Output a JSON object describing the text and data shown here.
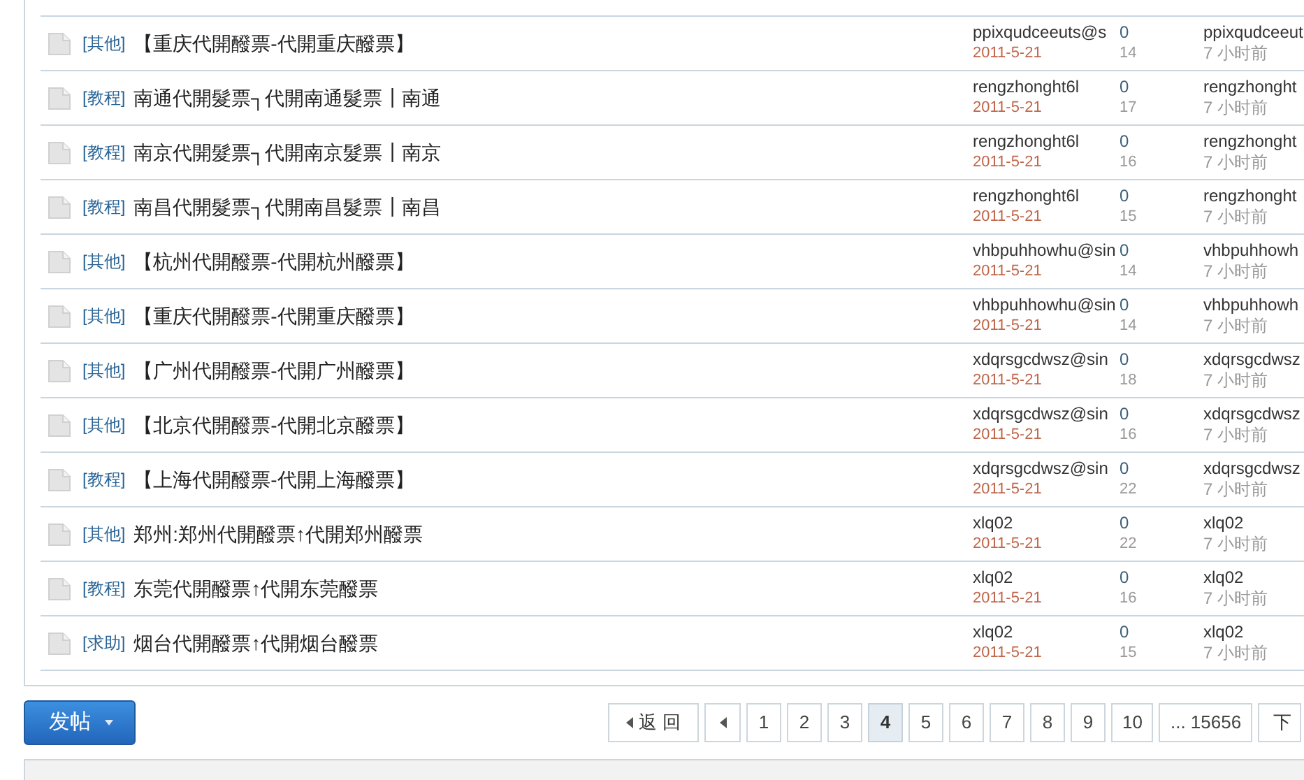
{
  "threads": [
    {
      "category": "[其他]",
      "title": "【重庆代開醱票-代開重庆醱票】",
      "author": "ppixqudceeuts@s",
      "date": "2011-5-21",
      "replies": "0",
      "views": "14",
      "last_poster": "ppixqudceeut",
      "last_time": "7 小时前"
    },
    {
      "category": "[教程]",
      "title": "南通代開髮票┐代開南通髮票┃南通",
      "author": "rengzhonght6l",
      "date": "2011-5-21",
      "replies": "0",
      "views": "17",
      "last_poster": "rengzhonght",
      "last_time": "7 小时前"
    },
    {
      "category": "[教程]",
      "title": "南京代開髮票┐代開南京髮票┃南京",
      "author": "rengzhonght6l",
      "date": "2011-5-21",
      "replies": "0",
      "views": "16",
      "last_poster": "rengzhonght",
      "last_time": "7 小时前"
    },
    {
      "category": "[教程]",
      "title": "南昌代開髮票┐代開南昌髮票┃南昌",
      "author": "rengzhonght6l",
      "date": "2011-5-21",
      "replies": "0",
      "views": "15",
      "last_poster": "rengzhonght",
      "last_time": "7 小时前"
    },
    {
      "category": "[其他]",
      "title": "【杭州代開醱票-代開杭州醱票】",
      "author": "vhbpuhhowhu@sin",
      "date": "2011-5-21",
      "replies": "0",
      "views": "14",
      "last_poster": "vhbpuhhowh",
      "last_time": "7 小时前"
    },
    {
      "category": "[其他]",
      "title": "【重庆代開醱票-代開重庆醱票】",
      "author": "vhbpuhhowhu@sin",
      "date": "2011-5-21",
      "replies": "0",
      "views": "14",
      "last_poster": "vhbpuhhowh",
      "last_time": "7 小时前"
    },
    {
      "category": "[其他]",
      "title": "【广州代開醱票-代開广州醱票】",
      "author": "xdqrsgcdwsz@sin",
      "date": "2011-5-21",
      "replies": "0",
      "views": "18",
      "last_poster": "xdqrsgcdwsz",
      "last_time": "7 小时前"
    },
    {
      "category": "[其他]",
      "title": "【北京代開醱票-代開北京醱票】",
      "author": "xdqrsgcdwsz@sin",
      "date": "2011-5-21",
      "replies": "0",
      "views": "16",
      "last_poster": "xdqrsgcdwsz",
      "last_time": "7 小时前"
    },
    {
      "category": "[教程]",
      "title": "【上海代開醱票-代開上海醱票】",
      "author": "xdqrsgcdwsz@sin",
      "date": "2011-5-21",
      "replies": "0",
      "views": "22",
      "last_poster": "xdqrsgcdwsz",
      "last_time": "7 小时前"
    },
    {
      "category": "[其他]",
      "title": "郑州:郑州代開醱票↑代開郑州醱票",
      "author": "xlq02",
      "date": "2011-5-21",
      "replies": "0",
      "views": "22",
      "last_poster": "xlq02",
      "last_time": "7 小时前"
    },
    {
      "category": "[教程]",
      "title": "东莞代開醱票↑代開东莞醱票",
      "author": "xlq02",
      "date": "2011-5-21",
      "replies": "0",
      "views": "16",
      "last_poster": "xlq02",
      "last_time": "7 小时前"
    },
    {
      "category": "[求助]",
      "title": "烟台代開醱票↑代開烟台醱票",
      "author": "xlq02",
      "date": "2011-5-21",
      "replies": "0",
      "views": "15",
      "last_poster": "xlq02",
      "last_time": "7 小时前"
    }
  ],
  "new_post_button": "发帖",
  "pagination": {
    "back": "返 回",
    "pages": [
      {
        "label": "1",
        "selected": false
      },
      {
        "label": "2",
        "selected": false
      },
      {
        "label": "3",
        "selected": false
      },
      {
        "label": "4",
        "selected": true
      },
      {
        "label": "5",
        "selected": false
      },
      {
        "label": "6",
        "selected": false
      },
      {
        "label": "7",
        "selected": false
      },
      {
        "label": "8",
        "selected": false
      },
      {
        "label": "9",
        "selected": false
      },
      {
        "label": "10",
        "selected": false
      },
      {
        "label": "... 15656",
        "selected": false
      }
    ],
    "next": "下"
  }
}
